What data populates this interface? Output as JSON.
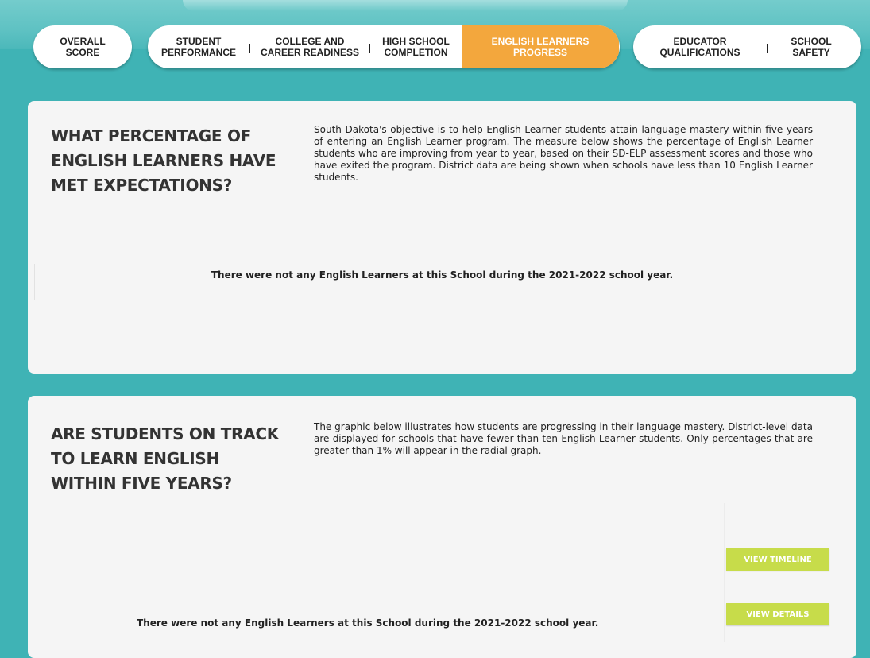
{
  "nav": {
    "tabs": [
      {
        "label": "OVERALL SCORE"
      },
      {
        "label": "STUDENT PERFORMANCE"
      },
      {
        "label": "COLLEGE AND CAREER READINESS"
      },
      {
        "label": "HIGH SCHOOL COMPLETION"
      },
      {
        "label": "ENGLISH LEARNERS PROGRESS",
        "active": true
      },
      {
        "label": "EDUCATOR QUALIFICATIONS"
      },
      {
        "label": "SCHOOL SAFETY"
      }
    ]
  },
  "section1": {
    "heading": "WHAT PERCENTAGE OF ENGLISH LEARNERS HAVE MET EXPECTATIONS?",
    "description": "South Dakota's objective is to help English Learner students attain language mastery within five years of entering an English Learner program. The measure below shows the percentage of English Learner students who are improving from year to year, based on their SD-ELP assessment scores and those who have exited the program. District data are being shown when schools have less than 10 English Learner students.",
    "notice": "There were not any English Learners at this School during the 2021-2022 school year."
  },
  "section2": {
    "heading": "ARE STUDENTS ON TRACK TO LEARN ENGLISH WITHIN FIVE YEARS?",
    "description": "The graphic below illustrates how students are progressing in their language mastery. District-level data are displayed for schools that have fewer than ten English Learner students.  Only percentages that are greater than 1% will appear in the radial graph.",
    "notice": "There were not any English Learners at this School during the 2021-2022 school year.",
    "view_timeline_label": "VIEW TIMELINE",
    "view_details_label": "VIEW DETAILS"
  },
  "colors": {
    "background": "#3fb3b5",
    "active_tab": "#f3a73d",
    "button": "#c7dc4a",
    "panel": "#f5f5f5"
  }
}
